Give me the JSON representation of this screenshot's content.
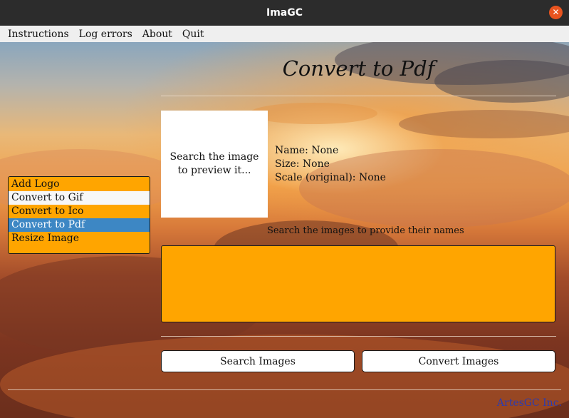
{
  "window": {
    "title": "ImaGC",
    "close_icon": "close-icon",
    "close_color": "#e9541f"
  },
  "menu": {
    "items": [
      "Instructions",
      "Log errors",
      "About",
      "Quit"
    ]
  },
  "page": {
    "title": "Convert to Pdf"
  },
  "preview": {
    "placeholder": "Search the image to preview it..."
  },
  "info": {
    "name": "Name: None",
    "size": "Size: None",
    "scale": "Scale (original): None"
  },
  "sidebar": {
    "items": [
      {
        "label": "Add Logo",
        "state": "normal"
      },
      {
        "label": "Convert to Gif",
        "state": "hover"
      },
      {
        "label": "Convert to Ico",
        "state": "normal"
      },
      {
        "label": "Convert to Pdf",
        "state": "selected"
      },
      {
        "label": "Resize Image",
        "state": "normal"
      }
    ]
  },
  "names": {
    "hint": "Search the images to provide their names",
    "value": ""
  },
  "buttons": {
    "search": "Search Images",
    "convert": "Convert Images"
  },
  "footer": {
    "credit": "ArtesGC Inc."
  },
  "colors": {
    "accent": "#ffa500",
    "selected": "#3d87c4",
    "credit": "#2b3bb0"
  }
}
